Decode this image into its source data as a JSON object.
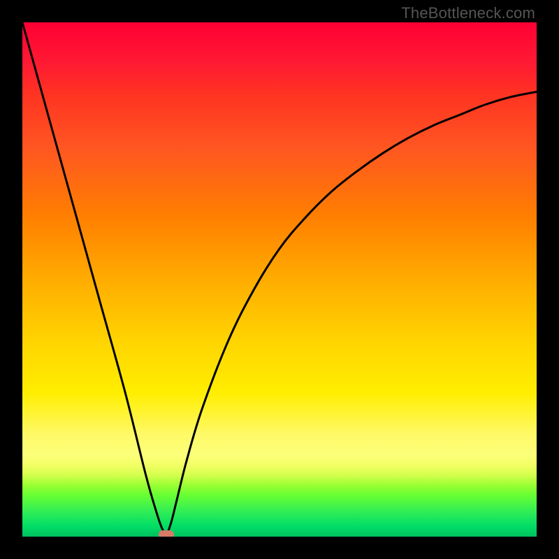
{
  "watermark": "TheBottleneck.com",
  "colors": {
    "frame": "#000000",
    "curve": "#000000",
    "marker": "#d97a66"
  },
  "chart_data": {
    "type": "line",
    "title": "",
    "xlabel": "",
    "ylabel": "",
    "xlim": [
      0,
      100
    ],
    "ylim": [
      0,
      100
    ],
    "grid": false,
    "series": [
      {
        "name": "left-branch",
        "x": [
          0,
          5,
          10,
          15,
          20,
          24,
          26,
          27,
          28
        ],
        "y": [
          100,
          82,
          64,
          46,
          28,
          12,
          5,
          2,
          0
        ]
      },
      {
        "name": "right-branch",
        "x": [
          28,
          29,
          30,
          32,
          35,
          40,
          45,
          50,
          55,
          60,
          65,
          70,
          75,
          80,
          85,
          90,
          95,
          100
        ],
        "y": [
          0,
          3,
          7,
          15,
          25,
          38,
          48,
          56,
          62,
          67,
          71,
          74.5,
          77.5,
          80,
          82,
          84,
          85.5,
          86.5
        ]
      }
    ],
    "annotations": [
      {
        "name": "min-marker",
        "x": 28,
        "y": 0
      }
    ]
  }
}
